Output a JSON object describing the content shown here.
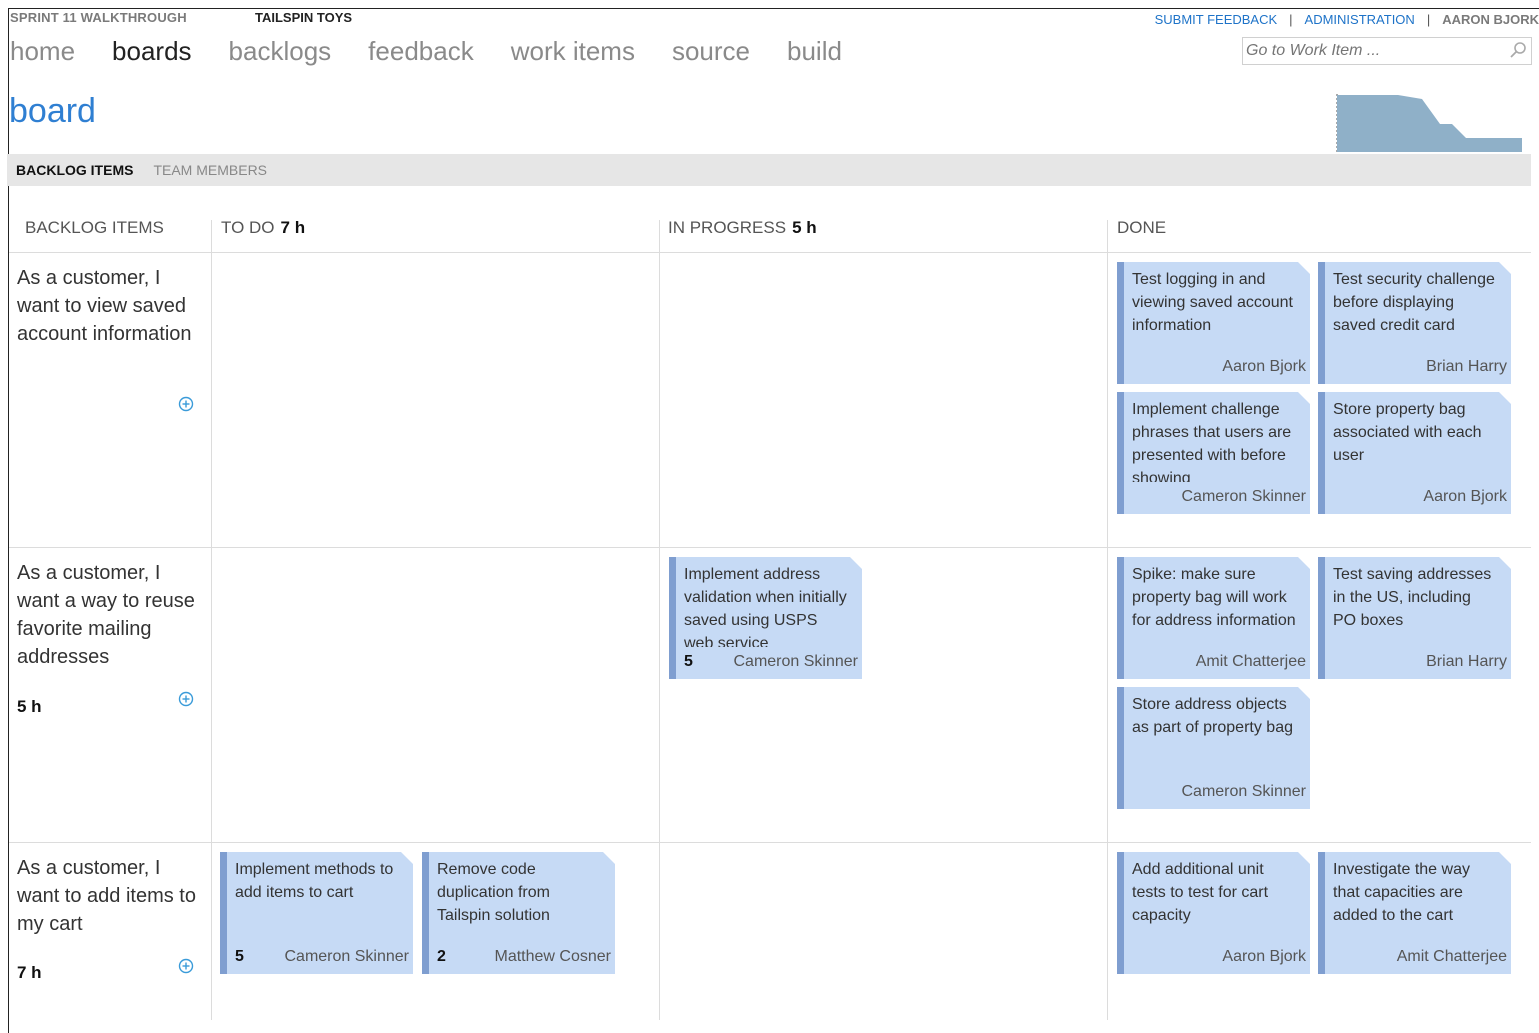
{
  "header": {
    "project": "SPRINT 11 WALKTHROUGH",
    "team": "TAILSPIN TOYS",
    "links": {
      "feedback": "SUBMIT FEEDBACK",
      "sep": "|",
      "admin": "ADMINISTRATION",
      "user": "AARON BJORK"
    },
    "search_placeholder": "Go to Work Item ..."
  },
  "nav": [
    "home",
    "boards",
    "backlogs",
    "feedback",
    "work items",
    "source",
    "build"
  ],
  "nav_active": "boards",
  "page_title": "board",
  "subtabs": {
    "active": "BACKLOG ITEMS",
    "inactive": "TEAM MEMBERS"
  },
  "columns": {
    "backlog": {
      "label": "BACKLOG ITEMS"
    },
    "todo": {
      "label": "TO DO",
      "hours": "7 h"
    },
    "inprogress": {
      "label": "IN PROGRESS",
      "hours": "5 h"
    },
    "done": {
      "label": "DONE"
    }
  },
  "rows": [
    {
      "story": "As a customer, I want to view saved account information",
      "hours": "",
      "done": [
        {
          "title": "Test logging in and viewing saved account information",
          "owner": "Aaron Bjork",
          "remaining": ""
        },
        {
          "title": "Test security challenge before displaying saved credit card",
          "owner": "Brian Harry",
          "remaining": ""
        },
        {
          "title": "Implement challenge phrases that users are presented with before showing",
          "owner": "Cameron Skinner",
          "remaining": ""
        },
        {
          "title": "Store property bag associated with each user",
          "owner": "Aaron Bjork",
          "remaining": ""
        }
      ]
    },
    {
      "story": "As a customer, I want a way to reuse favorite mailing addresses",
      "hours": "5 h",
      "inprogress": [
        {
          "title": "Implement address validation when initially saved using USPS web service",
          "owner": "Cameron Skinner",
          "remaining": "5"
        }
      ],
      "done": [
        {
          "title": "Spike: make sure property bag will work for address information",
          "owner": "Amit Chatterjee",
          "remaining": ""
        },
        {
          "title": "Test saving addresses in the US, including PO boxes",
          "owner": "Brian Harry",
          "remaining": ""
        },
        {
          "title": "Store address objects as part of property bag",
          "owner": "Cameron Skinner",
          "remaining": ""
        }
      ]
    },
    {
      "story": "As a customer, I want to add items to my cart",
      "hours": "7 h",
      "todo": [
        {
          "title": "Implement methods to add items to cart",
          "owner": "Cameron Skinner",
          "remaining": "5"
        },
        {
          "title": "Remove code duplication from Tailspin solution",
          "owner": "Matthew Cosner",
          "remaining": "2"
        }
      ],
      "done": [
        {
          "title": "Add additional unit tests to test for cart capacity",
          "owner": "Aaron Bjork",
          "remaining": ""
        },
        {
          "title": "Investigate the way that capacities are added to the cart",
          "owner": "Amit Chatterjee",
          "remaining": ""
        }
      ]
    }
  ],
  "colors": {
    "accent": "#2f7fd2",
    "card": "#c6daf5",
    "card_bar": "#7f9ed0",
    "burndown": "#8fb0c8"
  },
  "icons": {
    "search": "search-icon",
    "add": "add-task-icon",
    "burndown": "burndown-chart-icon"
  }
}
